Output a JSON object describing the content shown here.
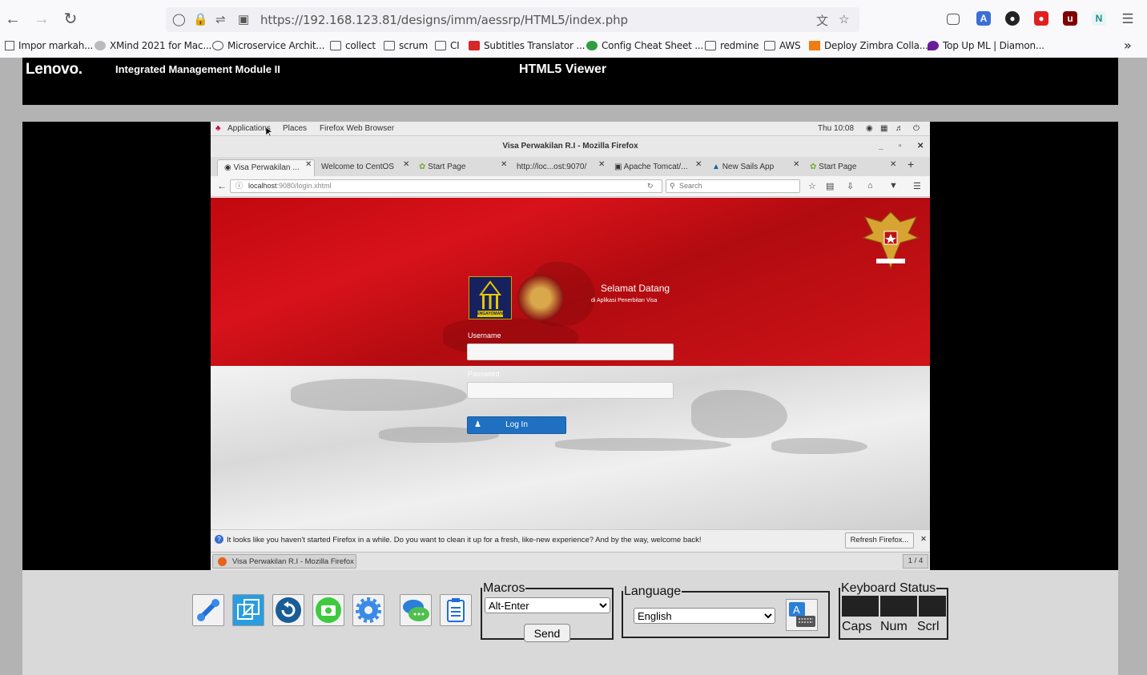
{
  "browser": {
    "url": "https://192.168.123.81/designs/imm/aessrp/HTML5/index.php",
    "bookmarks": [
      "Impor markah...",
      "XMind 2021 for Mac...",
      "Microservice Archit...",
      "collect",
      "scrum",
      "CI",
      "Subtitles Translator ...",
      "Config Cheat Sheet ...",
      "redmine",
      "AWS",
      "Deploy Zimbra Colla...",
      "Top Up ML | Diamon..."
    ]
  },
  "imm": {
    "brand": "Lenovo.",
    "title": "Integrated Management Module II",
    "viewer_title": "HTML5 Viewer"
  },
  "remote": {
    "gnome": {
      "applications": "Applications",
      "places": "Places",
      "firefox": "Firefox Web Browser",
      "clock": "Thu 10:08"
    },
    "window_title": "Visa Perwakilan R.I - Mozilla Firefox",
    "tabs": [
      "Visa Perwakilan ...",
      "Welcome to CentOS",
      "Start Page",
      "http://loc...ost:9070/",
      "Apache Tomcat/...",
      "New Sails App",
      "Start Page"
    ],
    "address": "localhost",
    "address_rest": ":9080/login.xhtml",
    "search_placeholder": "Search",
    "page": {
      "logo_text": "PENGAYOMAN",
      "welcome": "Selamat Datang",
      "welcome_sub": "di Aplikasi Penerbitan Visa",
      "username_label": "Username",
      "password_label": "Password",
      "login_button": "Log In"
    },
    "notification": "It looks like you haven't started Firefox in a while. Do you want to clean it up for a fresh, like-new experience? And by the way, welcome back!",
    "refresh_button": "Refresh Firefox...",
    "taskbar_item": "Visa Perwakilan R.I - Mozilla Firefox",
    "workspace": "1 / 4"
  },
  "toolbar": {
    "macros_legend": "Macros",
    "macro_selected": "Alt-Enter",
    "send_label": "Send",
    "language_legend": "Language",
    "language_selected": "English",
    "keyboard_legend": "Keyboard Status",
    "caps": "Caps",
    "num": "Num",
    "scrl": "Scrl"
  }
}
